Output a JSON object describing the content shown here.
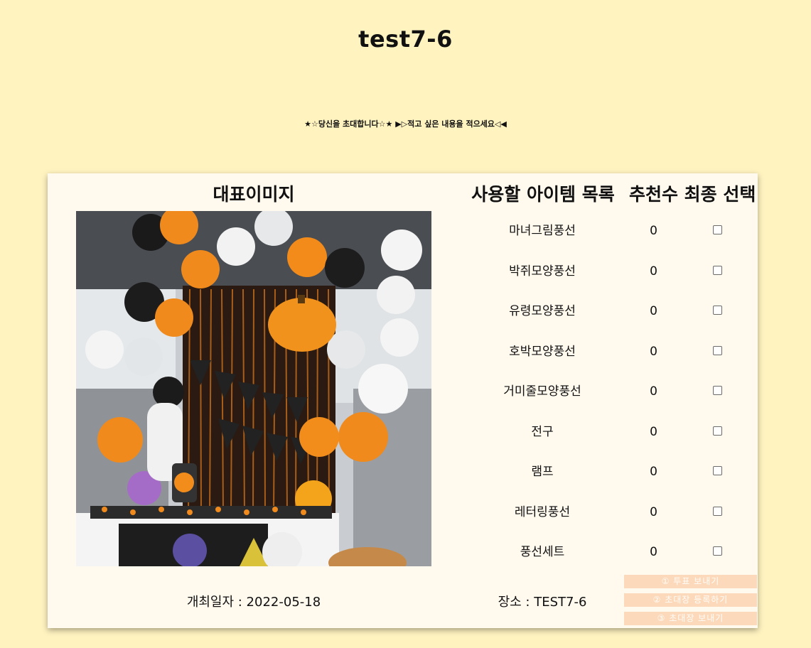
{
  "page": {
    "title": "test7-6",
    "invitation_message": "★☆당신을 초대합니다☆★ ▶▷적고 싶은 내용을 적으세요◁◀"
  },
  "table": {
    "image_header": "대표이미지",
    "items_header": "사용할 아이템 목록",
    "votes_header": "추천수",
    "final_header": "최종 선택",
    "items": [
      {
        "name": "마녀그림풍선",
        "votes": "0",
        "checked": false
      },
      {
        "name": "박쥐모양풍선",
        "votes": "0",
        "checked": false
      },
      {
        "name": "유령모양풍선",
        "votes": "0",
        "checked": false
      },
      {
        "name": "호박모양풍선",
        "votes": "0",
        "checked": false
      },
      {
        "name": "거미줄모양풍선",
        "votes": "0",
        "checked": false
      },
      {
        "name": "전구",
        "votes": "0",
        "checked": false
      },
      {
        "name": "램프",
        "votes": "0",
        "checked": false
      },
      {
        "name": "레터링풍선",
        "votes": "0",
        "checked": false
      },
      {
        "name": "풍선세트",
        "votes": "0",
        "checked": false
      }
    ]
  },
  "footer": {
    "date": "개최일자 : 2022-05-18",
    "place": "장소 : TEST7-6"
  },
  "actions": {
    "send_vote": "① 투표 보내기",
    "register_invitation": "② 초대장 등록하기",
    "send_invitation": "③ 초대장 보내기"
  },
  "colors": {
    "background": "#fff3c0",
    "card": "#fff9ee",
    "button": "#fcd9bb"
  }
}
